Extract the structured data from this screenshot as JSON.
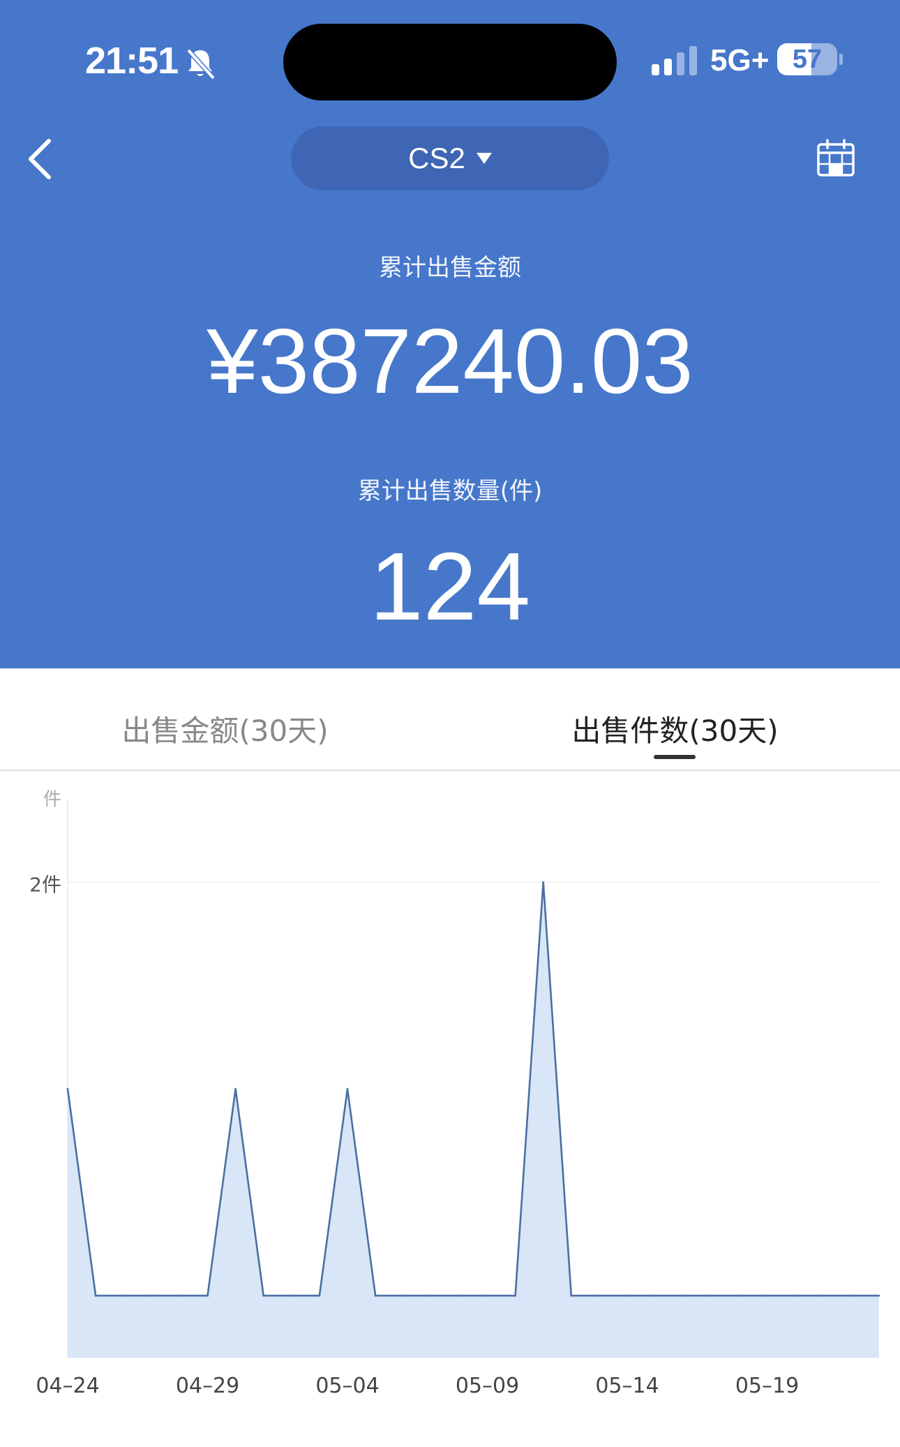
{
  "status_bar": {
    "time": "21:51",
    "network": "5G+",
    "battery": 57
  },
  "nav": {
    "selector_label": "CS2"
  },
  "summary": {
    "total_amount_label": "累计出售金额",
    "total_amount": "¥387240.03",
    "total_count_label": "累计出售数量(件)",
    "total_count": "124"
  },
  "tabs": [
    {
      "label": "出售金额(30天)",
      "active": false
    },
    {
      "label": "出售件数(30天)",
      "active": true
    }
  ],
  "colors": {
    "header_bg": "#4677cb",
    "line": "#4a6fa3",
    "area_fill": "#d9e6f7"
  },
  "chart_data": {
    "type": "area",
    "ylabel": "件",
    "y_ticks": [
      {
        "value": 2,
        "label": "2件"
      }
    ],
    "ylim": [
      -0.3,
      2.4
    ],
    "x": [
      "04-24",
      "04-25",
      "04-26",
      "04-27",
      "04-28",
      "04-29",
      "04-30",
      "05-01",
      "05-02",
      "05-03",
      "05-04",
      "05-05",
      "05-06",
      "05-07",
      "05-08",
      "05-09",
      "05-10",
      "05-11",
      "05-12",
      "05-13",
      "05-14",
      "05-15",
      "05-16",
      "05-17",
      "05-18",
      "05-19",
      "05-20",
      "05-21",
      "05-22",
      "05-23"
    ],
    "x_tick_labels": [
      "04–24",
      "04–29",
      "05–04",
      "05–09",
      "05–14",
      "05–19"
    ],
    "series": [
      {
        "values": [
          1,
          0,
          0,
          0,
          0,
          0,
          1,
          0,
          0,
          0,
          1,
          0,
          0,
          0,
          0,
          0,
          0,
          2,
          0,
          0,
          0,
          0,
          0,
          0,
          0,
          0,
          0,
          0,
          0,
          0
        ]
      }
    ]
  }
}
